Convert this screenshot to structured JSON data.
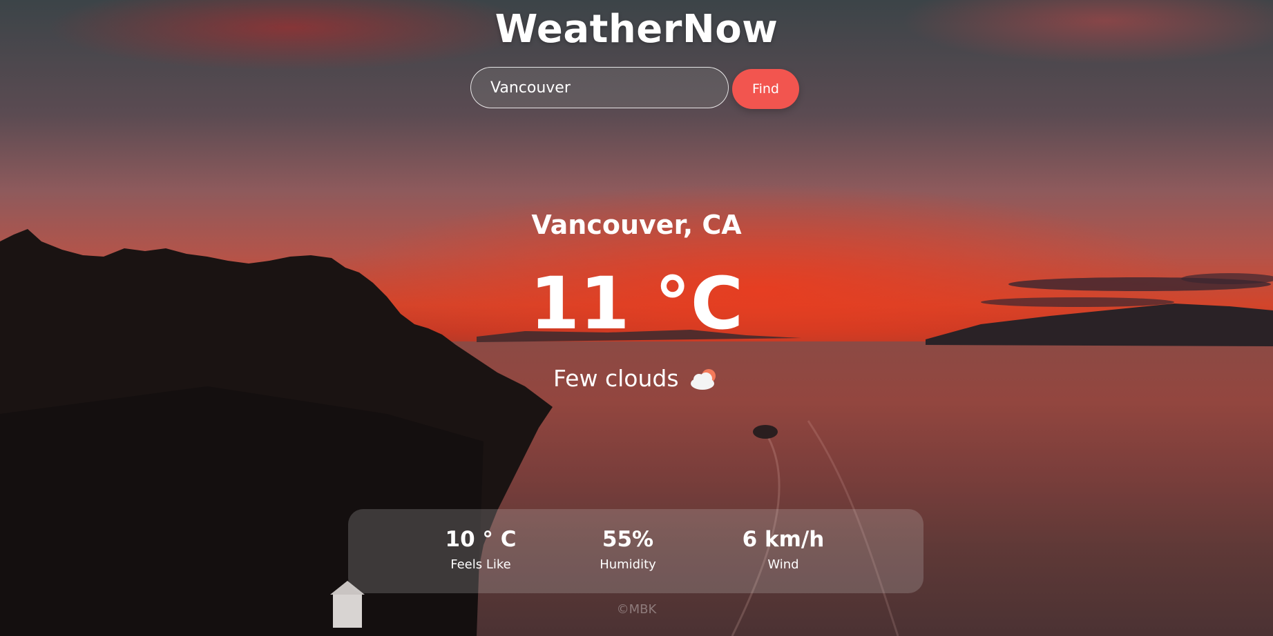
{
  "header": {
    "title": "WeatherNow"
  },
  "search": {
    "value": "Vancouver",
    "button_label": "Find"
  },
  "current": {
    "location": "Vancouver, CA",
    "temperature": "11 °C",
    "condition": "Few clouds",
    "condition_icon": "cloud-icon"
  },
  "stats": [
    {
      "value": "10 ° C",
      "label": "Feels Like"
    },
    {
      "value": "55%",
      "label": "Humidity"
    },
    {
      "value": "6 km/h",
      "label": "Wind"
    }
  ],
  "footer": {
    "text": "©MBK"
  },
  "colors": {
    "accent": "#f2554f",
    "text": "#ffffff"
  }
}
